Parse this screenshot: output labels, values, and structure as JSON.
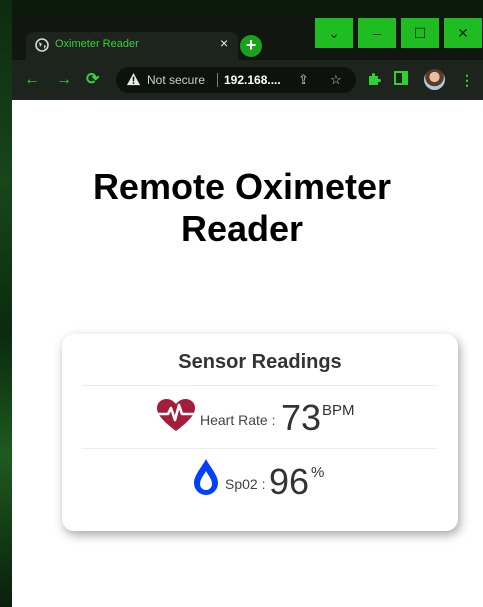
{
  "browser": {
    "tab": {
      "title": "Oximeter Reader",
      "close": "×"
    },
    "new_tab": "+",
    "window_controls": {
      "dropdown": "⌄",
      "minimize": "–",
      "maximize": "☐",
      "close": "✕"
    },
    "nav": {
      "back": "←",
      "forward": "→",
      "reload": "⟳"
    },
    "omnibox": {
      "security": "Not secure",
      "url": "192.168....",
      "share": "⇪",
      "bookmark": "☆"
    },
    "toolbar_icons": {
      "extensions": "puzzle-icon",
      "sidepanel": "sidepanel-icon",
      "menu": "⋮"
    }
  },
  "page": {
    "title": "Remote Oximeter Reader",
    "card": {
      "title": "Sensor Readings",
      "heart": {
        "label": "Heart Rate :",
        "value": "73",
        "unit": "BPM",
        "color": "#a51d3c"
      },
      "spo2": {
        "label": "Sp02 :",
        "value": "96",
        "unit": "%",
        "color": "#0040ff"
      }
    }
  },
  "colors": {
    "accent_green": "#1fbd22",
    "text_green": "#37d33c"
  }
}
